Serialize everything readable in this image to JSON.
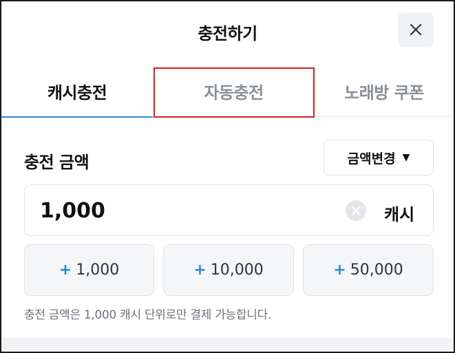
{
  "header": {
    "title": "충전하기",
    "close_icon": "close-icon"
  },
  "tabs": [
    {
      "label": "캐시충전",
      "active": true
    },
    {
      "label": "자동충전",
      "active": false
    },
    {
      "label": "노래방 쿠폰",
      "active": false
    }
  ],
  "amount": {
    "section_label": "충전 금액",
    "change_button_label": "금액변경",
    "value": "1,000",
    "unit": "캐시"
  },
  "quick_add": [
    {
      "sign": "+",
      "label": "1,000"
    },
    {
      "sign": "+",
      "label": "10,000"
    },
    {
      "sign": "+",
      "label": "50,000"
    }
  ],
  "notice": "충전 금액은 1,000 캐시 단위로만 결제 가능합니다.",
  "colors": {
    "accent": "#2a8bd6",
    "highlight": "#d21e1e"
  }
}
